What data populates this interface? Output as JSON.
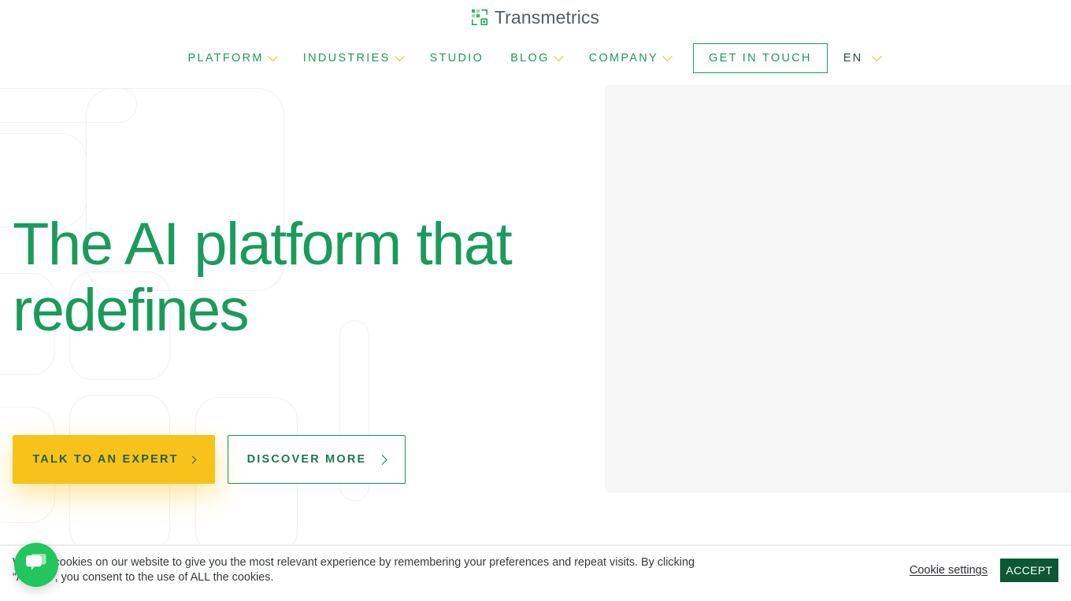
{
  "brand": {
    "name": "Transmetrics",
    "logo_icon": "transmetrics-blocks-icon",
    "green": "#1a9b5d",
    "dark_green": "#0d5734",
    "yellow": "#f7c31a",
    "logo_text_color": "#555d63"
  },
  "nav": {
    "items": [
      {
        "label": "PLATFORM",
        "has_dropdown": true,
        "icon": "chevron-down-icon"
      },
      {
        "label": "INDUSTRIES",
        "has_dropdown": true,
        "icon": "chevron-down-icon"
      },
      {
        "label": "STUDIO",
        "has_dropdown": false,
        "icon": ""
      },
      {
        "label": "BLOG",
        "has_dropdown": true,
        "icon": "chevron-down-icon"
      },
      {
        "label": "COMPANY",
        "has_dropdown": true,
        "icon": "chevron-down-icon"
      }
    ],
    "cta_label": "GET IN TOUCH",
    "language": "EN",
    "language_icon": "chevron-down-icon"
  },
  "hero": {
    "title_line1": "The AI platform that",
    "title_line2": "redefines",
    "primary_cta": "TALK TO AN EXPERT",
    "primary_cta_icon": "chevron-right-icon",
    "secondary_cta": "DISCOVER MORE",
    "secondary_cta_icon": "chevron-right-icon",
    "media_placeholder_color": "#f6f6f6"
  },
  "cookie_banner": {
    "message": "We use cookies on our website to give you the most relevant experience by remembering your preferences and repeat visits. By clicking “Accept”, you consent to the use of ALL the cookies.",
    "settings_label": "Cookie settings",
    "accept_label": "ACCEPT"
  },
  "chat": {
    "icon": "chat-bubble-icon",
    "color": "#22c55e"
  }
}
